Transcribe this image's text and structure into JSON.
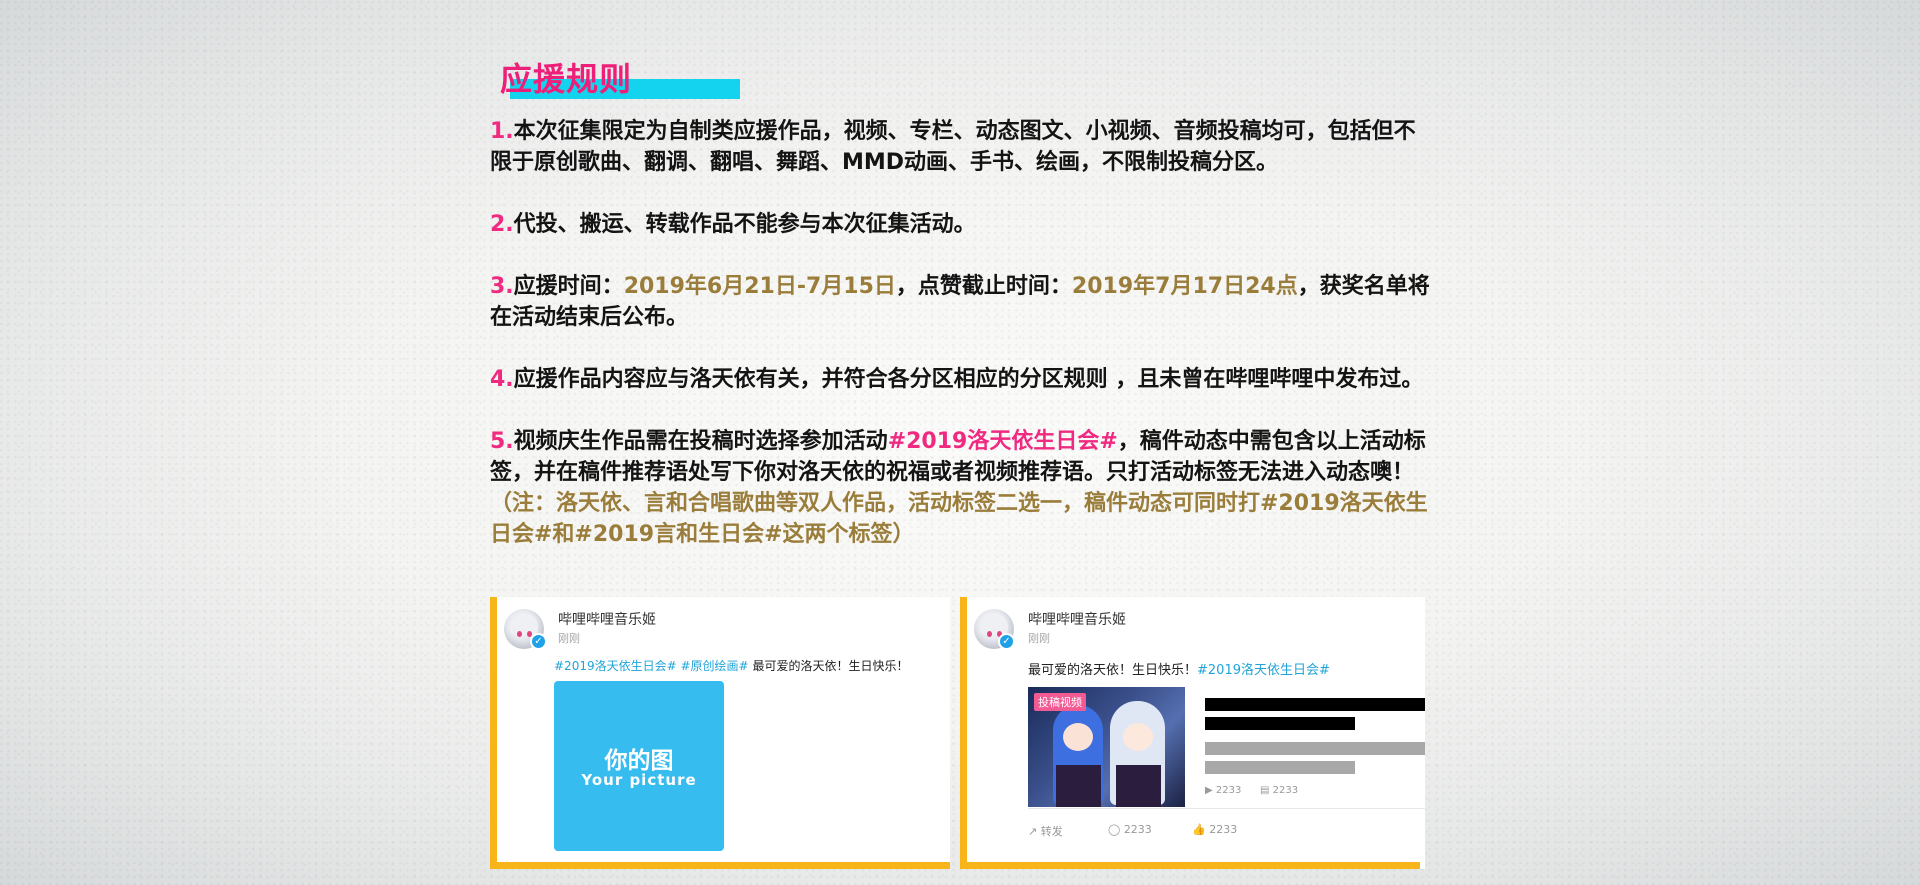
{
  "rules_title": "应援规则",
  "rules": [
    {
      "num": "1.",
      "segments": [
        {
          "t": "本次征集限定为自制类应援作品，视频、专栏、动态图文、小视频、音频投稿均可，包括但不限于原创歌曲、翻调、翻唱、舞蹈、MMD动画、手书、绘画，不限制投稿分区。",
          "s": "plain"
        }
      ]
    },
    {
      "num": "2.",
      "segments": [
        {
          "t": "代投、搬运、转载作品不能参与本次征集活动。",
          "s": "plain"
        }
      ]
    },
    {
      "num": "3.",
      "segments": [
        {
          "t": "应援时间：",
          "s": "plain"
        },
        {
          "t": "2019年6月21日-7月15日",
          "s": "gold"
        },
        {
          "t": "，点赞截止时间：",
          "s": "plain"
        },
        {
          "t": "2019年7月17日24点",
          "s": "gold"
        },
        {
          "t": "，获奖名单将在活动结束后公布。",
          "s": "plain"
        }
      ]
    },
    {
      "num": "4.",
      "segments": [
        {
          "t": "应援作品内容应与洛天依有关，并符合各分区相应的分区规则 ，且未曾在哔哩哔哩中发布过。",
          "s": "plain"
        }
      ]
    },
    {
      "num": "5.",
      "segments": [
        {
          "t": "视频庆生作品需在投稿时选择参加活动",
          "s": "plain"
        },
        {
          "t": "#2019洛天依生日会#",
          "s": "pink"
        },
        {
          "t": "，稿件动态中需包含以上活动标签，并在稿件推荐语处写下你对洛天依的祝福或者视频推荐语。只打活动标签无法进入动态噢！",
          "s": "plain"
        },
        {
          "t": "（注：洛天依、言和合唱歌曲等双人作品，活动标签二选一，稿件动态可同时打#2019洛天依生日会#和#2019言和生日会#这两个标签）",
          "s": "gold"
        }
      ]
    }
  ],
  "example_left": {
    "username": "哔哩哔哩音乐姬",
    "time": "刚刚",
    "tag1": "#2019洛天依生日会#",
    "tag2": "#原创绘画#",
    "text": "最可爱的洛天依！生日快乐！",
    "picture_cn": "你的图",
    "picture_en": "Your picture"
  },
  "example_right": {
    "username": "哔哩哔哩音乐姬",
    "time": "刚刚",
    "text": "最可爱的洛天依！生日快乐！",
    "tag": "#2019洛天依生日会#",
    "thumb_label": "投稿视频",
    "play_count": "2233",
    "danmaku_count": "2233",
    "forward_label": "转发",
    "comment_count": "2233",
    "like_count": "2233"
  },
  "colors": {
    "accent_pink": "#ef2a80",
    "accent_cyan": "#13d3ee",
    "gold_text": "#9a7d3a",
    "frame_yellow": "#f7b519",
    "tag_blue": "#20a4d8",
    "picture_blue": "#37bcef"
  }
}
